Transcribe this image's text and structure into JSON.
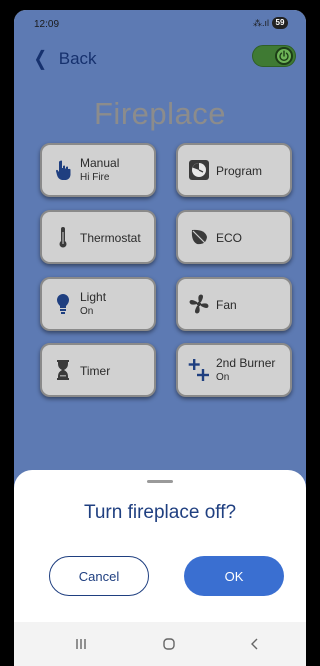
{
  "status_bar": {
    "time": "12:09",
    "signal_text": "⁂.ıl",
    "battery": "59"
  },
  "header": {
    "back_label": "Back",
    "power_toggle_on": true
  },
  "page_title": "Fireplace",
  "tiles": [
    {
      "label": "Manual",
      "sub": "Hi Fire",
      "icon": "hand-pointer-icon"
    },
    {
      "label": "Program",
      "sub": "",
      "icon": "clock-icon"
    },
    {
      "label": "Thermostat",
      "sub": "",
      "icon": "thermometer-icon"
    },
    {
      "label": "ECO",
      "sub": "",
      "icon": "leaf-icon"
    },
    {
      "label": "Light",
      "sub": "On",
      "icon": "lightbulb-icon"
    },
    {
      "label": "Fan",
      "sub": "",
      "icon": "fan-icon"
    },
    {
      "label": "Timer",
      "sub": "",
      "icon": "hourglass-icon"
    },
    {
      "label": "2nd Burner",
      "sub": "On",
      "icon": "plus-plus-icon"
    }
  ],
  "dialog": {
    "title": "Turn fireplace off?",
    "cancel_label": "Cancel",
    "ok_label": "OK"
  },
  "colors": {
    "background": "#5d7ab3",
    "accent": "#3a6fd1",
    "dialog_text": "#1f3f80",
    "toggle_on": "#3f7a33"
  }
}
